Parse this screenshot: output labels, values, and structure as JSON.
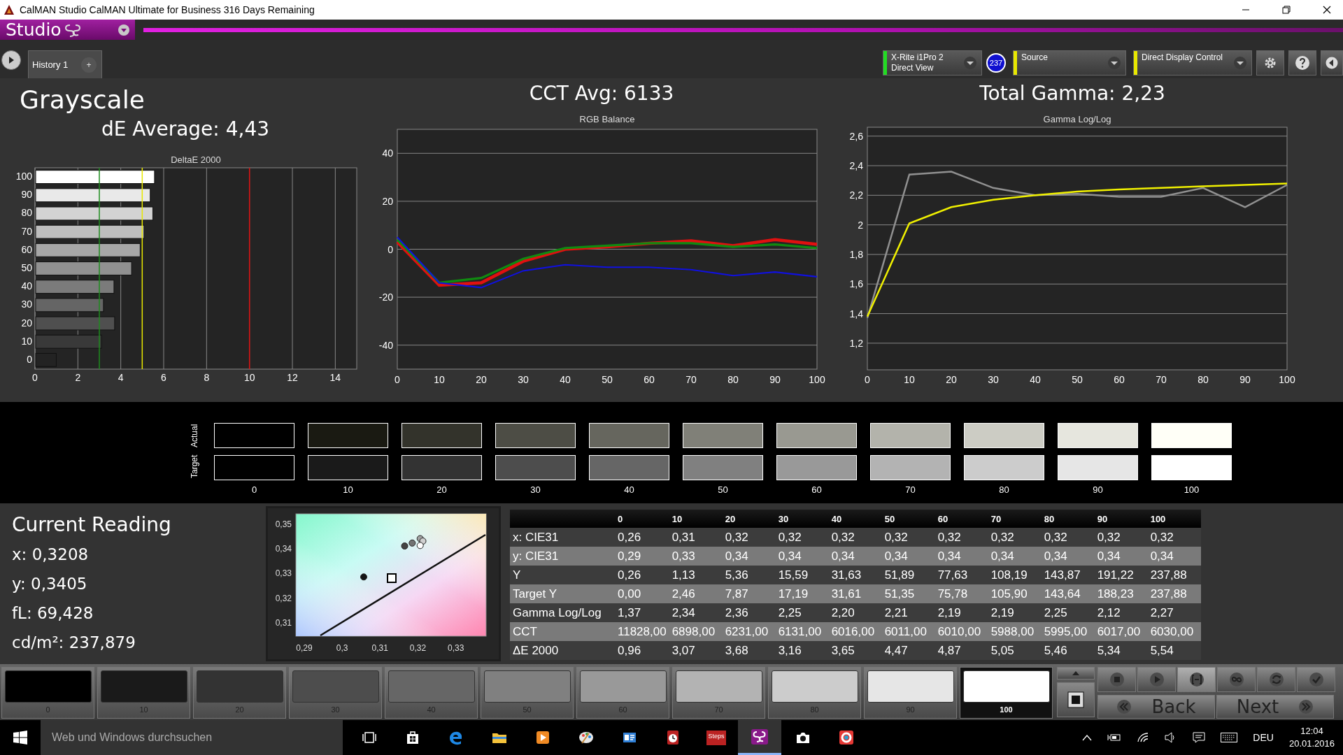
{
  "window": {
    "title": "CalMAN Studio CalMAN Ultimate for Business 316 Days Remaining"
  },
  "menu": {
    "logo": "Studio"
  },
  "toolbar": {
    "tabs": [
      {
        "label": "History 1",
        "selected": true
      }
    ],
    "add_tab": "+",
    "devices": [
      {
        "kind": "meter",
        "lines": [
          "X-Rite i1Pro 2",
          "Direct View"
        ],
        "color": "#22dd22",
        "badge": "237"
      },
      {
        "kind": "source",
        "lines": [
          "Source"
        ],
        "color": "#e8e800"
      },
      {
        "kind": "display",
        "lines": [
          "Direct Display Control"
        ],
        "color": "#e8e800"
      }
    ]
  },
  "header": {
    "title": "Grayscale",
    "de_average": "dE Average: 4,43",
    "cct_avg": "CCT Avg: 6133",
    "total_gamma": "Total Gamma: 2,23"
  },
  "deltae_chart": {
    "chart_data": {
      "type": "bar",
      "orientation": "horizontal",
      "title": "DeltaE 2000",
      "categories": [
        "100",
        "90",
        "80",
        "70",
        "60",
        "50",
        "40",
        "30",
        "20",
        "10",
        "0"
      ],
      "values": [
        5.54,
        5.34,
        5.46,
        5.05,
        4.87,
        4.47,
        3.65,
        3.16,
        3.68,
        3.07,
        0.96
      ],
      "xlim": [
        0,
        15
      ],
      "xticks": [
        0,
        2,
        4,
        6,
        8,
        10,
        12,
        14
      ],
      "grid": true,
      "ref_lines": [
        {
          "axis": "x",
          "value": 3,
          "color": "#1e8c1e"
        },
        {
          "axis": "x",
          "value": 5,
          "color": "#e8e800"
        },
        {
          "axis": "x",
          "value": 10,
          "color": "#e01010"
        }
      ]
    }
  },
  "rgb_chart": {
    "chart_data": {
      "type": "line",
      "title": "RGB Balance",
      "x": [
        0,
        10,
        20,
        30,
        40,
        50,
        60,
        70,
        80,
        90,
        100
      ],
      "xlim": [
        0,
        100
      ],
      "ylim": [
        -50,
        50
      ],
      "xticks": [
        0,
        10,
        20,
        30,
        40,
        50,
        60,
        70,
        80,
        90,
        100
      ],
      "yticks": [
        -40,
        -20,
        0,
        20,
        40
      ],
      "grid": true,
      "series": [
        {
          "color": "#e01010",
          "values": [
            3,
            -15,
            -14,
            -5,
            0,
            1,
            2.5,
            3.5,
            1.5,
            4,
            2
          ]
        },
        {
          "color": "#108a10",
          "values": [
            4,
            -14,
            -12,
            -4,
            0.5,
            1.5,
            2.5,
            2.5,
            1,
            2,
            0.5
          ]
        },
        {
          "color": "#1010e0",
          "values": [
            5,
            -14,
            -16,
            -9,
            -6.5,
            -7.5,
            -7.5,
            -8.5,
            -11,
            -9.5,
            -11.5
          ]
        }
      ]
    }
  },
  "gamma_chart": {
    "chart_data": {
      "type": "line",
      "title": "Gamma Log/Log",
      "x": [
        0,
        10,
        20,
        30,
        40,
        50,
        60,
        70,
        80,
        90,
        100
      ],
      "xlim": [
        0,
        100
      ],
      "ylim": [
        1.02,
        2.66
      ],
      "xticks": [
        0,
        10,
        20,
        30,
        40,
        50,
        60,
        70,
        80,
        90,
        100
      ],
      "grid": true,
      "yticks": [
        {
          "value": 1.2,
          "label": "1,2"
        },
        {
          "value": 1.4,
          "label": "1,4"
        },
        {
          "value": 1.6,
          "label": "1,6"
        },
        {
          "value": 1.8,
          "label": "1,8"
        },
        {
          "value": 2,
          "label": "2"
        },
        {
          "value": 2.2,
          "label": "2,2"
        },
        {
          "value": 2.4,
          "label": "2,4"
        },
        {
          "value": 2.6,
          "label": "2,6"
        }
      ],
      "series": [
        {
          "color": "#909090",
          "values": [
            1.37,
            2.34,
            2.36,
            2.25,
            2.2,
            2.21,
            2.19,
            2.19,
            2.25,
            2.12,
            2.27
          ]
        },
        {
          "color": "#f0f000",
          "values": [
            1.38,
            2.01,
            2.12,
            2.17,
            2.2,
            2.225,
            2.24,
            2.25,
            2.26,
            2.27,
            2.28
          ]
        }
      ]
    }
  },
  "swatches": {
    "row_labels": [
      "Actual",
      "Target"
    ],
    "steps": [
      {
        "label": "0"
      },
      {
        "label": "10"
      },
      {
        "label": "20"
      },
      {
        "label": "30"
      },
      {
        "label": "40"
      },
      {
        "label": "50"
      },
      {
        "label": "60"
      },
      {
        "label": "70"
      },
      {
        "label": "80"
      },
      {
        "label": "90"
      },
      {
        "label": "100"
      }
    ]
  },
  "reading": {
    "title": "Current Reading",
    "lines": [
      "x: 0,3208",
      "y: 0,3405",
      "fL: 69,428",
      "cd/m²: 237,879"
    ]
  },
  "cie_chart": {
    "chart_data": {
      "type": "scatter",
      "xlim": [
        0.2878,
        0.338
      ],
      "ylim": [
        0.3045,
        0.3543
      ],
      "xticks": [
        {
          "value": 0.29,
          "label": "0,29"
        },
        {
          "value": 0.3,
          "label": "0,3"
        },
        {
          "value": 0.31,
          "label": "0,31"
        },
        {
          "value": 0.32,
          "label": "0,32"
        },
        {
          "value": 0.33,
          "label": "0,33"
        }
      ],
      "yticks": [
        {
          "value": 0.31,
          "label": "0,31"
        },
        {
          "value": 0.32,
          "label": "0,32"
        },
        {
          "value": 0.33,
          "label": "0,33"
        },
        {
          "value": 0.34,
          "label": "0,34"
        },
        {
          "value": 0.35,
          "label": "0,35"
        }
      ],
      "x": [
        0.3057,
        0.3165,
        0.3185,
        0.3206,
        0.3213,
        0.3206
      ],
      "values": [
        0.3286,
        0.3412,
        0.3424,
        0.3442,
        0.3432,
        0.3414
      ]
    }
  },
  "table": {
    "columns": [
      "0",
      "10",
      "20",
      "30",
      "40",
      "50",
      "60",
      "70",
      "80",
      "90",
      "100"
    ],
    "rows": [
      {
        "label": "x: CIE31",
        "cells": [
          "0,26",
          "0,31",
          "0,32",
          "0,32",
          "0,32",
          "0,32",
          "0,32",
          "0,32",
          "0,32",
          "0,32",
          "0,32"
        ]
      },
      {
        "label": "y: CIE31",
        "cells": [
          "0,29",
          "0,33",
          "0,34",
          "0,34",
          "0,34",
          "0,34",
          "0,34",
          "0,34",
          "0,34",
          "0,34",
          "0,34"
        ]
      },
      {
        "label": "Y",
        "cells": [
          "0,26",
          "1,13",
          "5,36",
          "15,59",
          "31,63",
          "51,89",
          "77,63",
          "108,19",
          "143,87",
          "191,22",
          "237,88"
        ]
      },
      {
        "label": "Target Y",
        "cells": [
          "0,00",
          "2,46",
          "7,87",
          "17,19",
          "31,61",
          "51,35",
          "75,78",
          "105,90",
          "143,64",
          "188,23",
          "237,88"
        ]
      },
      {
        "label": "Gamma Log/Log",
        "cells": [
          "1,37",
          "2,34",
          "2,36",
          "2,25",
          "2,20",
          "2,21",
          "2,19",
          "2,19",
          "2,25",
          "2,12",
          "2,27"
        ]
      },
      {
        "label": "CCT",
        "cells": [
          "11828,00",
          "6898,00",
          "6231,00",
          "6131,00",
          "6016,00",
          "6011,00",
          "6010,00",
          "5988,00",
          "5995,00",
          "6017,00",
          "6030,00"
        ]
      },
      {
        "label": "ΔE 2000",
        "cells": [
          "0,96",
          "3,07",
          "3,68",
          "3,16",
          "3,65",
          "4,47",
          "4,87",
          "5,05",
          "5,46",
          "5,34",
          "5,54"
        ]
      }
    ]
  },
  "patches": [
    {
      "label": "0",
      "selected": false
    },
    {
      "label": "10",
      "selected": false
    },
    {
      "label": "20",
      "selected": false
    },
    {
      "label": "30",
      "selected": false
    },
    {
      "label": "40",
      "selected": false
    },
    {
      "label": "50",
      "selected": false
    },
    {
      "label": "60",
      "selected": false
    },
    {
      "label": "70",
      "selected": false
    },
    {
      "label": "80",
      "selected": false
    },
    {
      "label": "90",
      "selected": false
    },
    {
      "label": "100",
      "selected": true
    }
  ],
  "controls": {
    "back": "Back",
    "next": "Next"
  },
  "taskbar": {
    "search_placeholder": "Web und Windows durchsuchen",
    "apps": [
      {
        "kind": "task-view",
        "active": false
      },
      {
        "kind": "store",
        "active": false
      },
      {
        "kind": "edge",
        "active": false
      },
      {
        "kind": "explorer",
        "active": false
      },
      {
        "kind": "media",
        "active": false
      },
      {
        "kind": "paint",
        "active": false
      },
      {
        "kind": "contacts",
        "active": false
      },
      {
        "kind": "timer",
        "active": false
      },
      {
        "kind": "steps",
        "active": false
      },
      {
        "kind": "calman",
        "active": true
      },
      {
        "kind": "camera",
        "active": false
      },
      {
        "kind": "record",
        "active": false
      }
    ],
    "steps_label": "Steps",
    "language": "DEU",
    "time": "12:04",
    "date": "20.01.2016"
  }
}
